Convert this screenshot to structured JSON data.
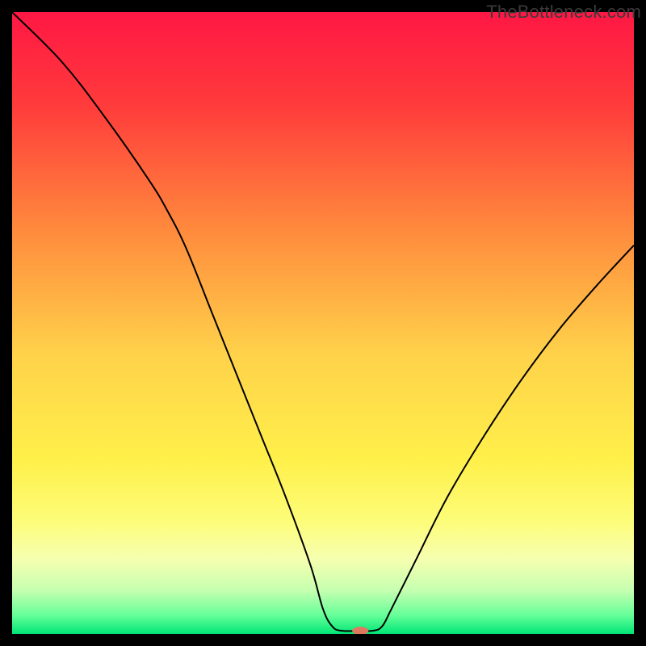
{
  "watermark": "TheBottleneck.com",
  "chart_data": {
    "type": "line",
    "title": "",
    "xlabel": "",
    "ylabel": "",
    "xlim": [
      0,
      100
    ],
    "ylim": [
      0,
      100
    ],
    "grid": false,
    "curve_points": [
      {
        "x": 0,
        "y": 100
      },
      {
        "x": 8,
        "y": 92
      },
      {
        "x": 15,
        "y": 83
      },
      {
        "x": 22,
        "y": 73
      },
      {
        "x": 25,
        "y": 68
      },
      {
        "x": 28,
        "y": 62
      },
      {
        "x": 32,
        "y": 52
      },
      {
        "x": 36,
        "y": 42
      },
      {
        "x": 40,
        "y": 32
      },
      {
        "x": 44,
        "y": 22
      },
      {
        "x": 48,
        "y": 11
      },
      {
        "x": 50,
        "y": 4
      },
      {
        "x": 51.5,
        "y": 1.2
      },
      {
        "x": 53,
        "y": 0.5
      },
      {
        "x": 56,
        "y": 0.5
      },
      {
        "x": 58,
        "y": 0.5
      },
      {
        "x": 59.5,
        "y": 1.2
      },
      {
        "x": 61,
        "y": 4
      },
      {
        "x": 65,
        "y": 12
      },
      {
        "x": 70,
        "y": 22
      },
      {
        "x": 76,
        "y": 32
      },
      {
        "x": 82,
        "y": 41
      },
      {
        "x": 88,
        "y": 49
      },
      {
        "x": 94,
        "y": 56
      },
      {
        "x": 100,
        "y": 62.5
      }
    ],
    "marker": {
      "x": 56,
      "y": 0.5,
      "color": "#e07860",
      "rx": 10,
      "ry": 5
    },
    "background": {
      "type": "vertical-gradient",
      "stops": [
        {
          "pos": 0,
          "color": "#ff1744"
        },
        {
          "pos": 0.15,
          "color": "#ff3b3b"
        },
        {
          "pos": 0.35,
          "color": "#ff8a3d"
        },
        {
          "pos": 0.55,
          "color": "#ffd24a"
        },
        {
          "pos": 0.72,
          "color": "#fff04a"
        },
        {
          "pos": 0.82,
          "color": "#fdfd7a"
        },
        {
          "pos": 0.88,
          "color": "#f6ffb0"
        },
        {
          "pos": 0.93,
          "color": "#c6ffb0"
        },
        {
          "pos": 0.97,
          "color": "#66ff99"
        },
        {
          "pos": 1.0,
          "color": "#00e676"
        }
      ]
    },
    "curve_color": "#000000",
    "curve_width": 2
  }
}
